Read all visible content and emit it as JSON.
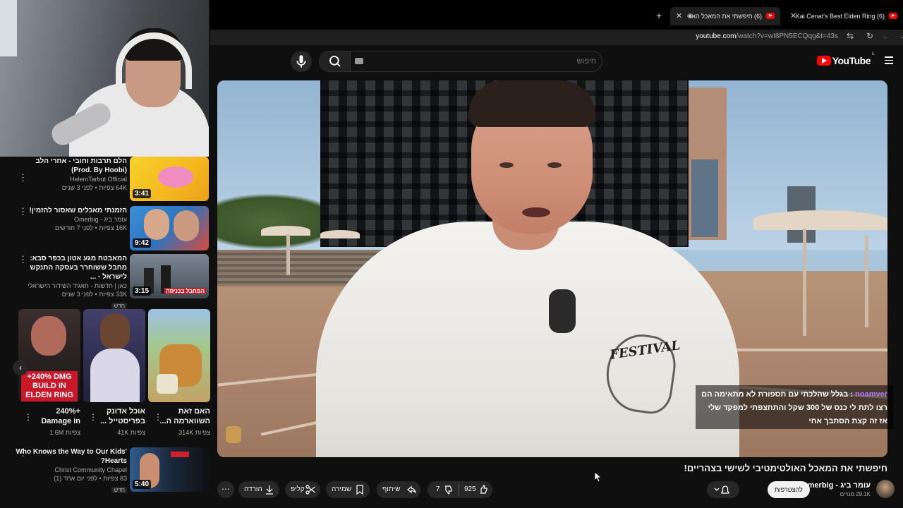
{
  "browser": {
    "tabs": [
      {
        "label": "(6) Kai Cenat's Best Elden Ring",
        "active": false
      },
      {
        "label": "(6) חיפשתי את המאכל האו",
        "active": true
      }
    ],
    "url_host": "youtube.com",
    "url_path": "/watch?v=wI8PN5ECQqg&t=43s"
  },
  "youtube": {
    "logo_text": "YouTube",
    "logo_sup": "IL",
    "search_placeholder": "חיפוש"
  },
  "sidebar": {
    "recs": [
      {
        "title": "הלם תרבות וחובי - אחרי הלב (Prod. By Hoobi)",
        "channel": "HelemTarbut Official",
        "meta": "64K צפיות • לפני 3 שנים",
        "duration": "3:41",
        "new": ""
      },
      {
        "title": "הזמנתי מאכלים שאסור להזמין!",
        "channel": "עומר ביג - Omerbig",
        "meta": "16K צפיות • לפני 7 חודשים",
        "duration": "9:42",
        "new": ""
      },
      {
        "title": "המאבטח מגע אטון בכפר סבא: מחבל ששוחרר בעסקה התנקש לישראל - ...",
        "channel": "כאן | חדשות - תאגיד השידור הישראלי",
        "meta": "33K צפיות • לפני 3 שנים",
        "duration": "3:15",
        "new": "חדש"
      },
      {
        "title": "Who Knows the Way to Our Kids' Hearts?",
        "channel": "Christ Community Chapel",
        "meta": "83 צפיות • לפני יום אחד (1)",
        "duration": "5:40",
        "new": "חדש"
      }
    ],
    "shorts": [
      {
        "title": "+240% Damage in",
        "views": "1.6M צפיות",
        "overlay": "+240% DMG BUILD IN ELDEN RING"
      },
      {
        "title": "אוכל אדונק בפריסטייל ...",
        "views": "41K צפיות",
        "overlay": ""
      },
      {
        "title": "האם זאת השווארמה ה...",
        "views": "314K צפיות",
        "overlay": ""
      }
    ],
    "thumb3_caption": "המחבל בכניסה"
  },
  "video": {
    "title": "חיפשתי את המאכל האולטימטיבי לשישי בצהריים!",
    "shirt_text": "FESTIVAL",
    "chat": {
      "author": "noamver",
      "message": "בגלל שהלכתי עם תספורת לא מתאימה הם רצו לתת לי כנס של 300 שקל והתחצפתי למפקד שלי אז זה קצת הסתבך אחי"
    }
  },
  "channel": {
    "name": "עומר ביג - Omerbig",
    "subs": "29.1K מנויים",
    "join_label": "להצטרפות"
  },
  "actions": {
    "likes": "925",
    "dislikes": "7",
    "share": "שיתוף",
    "save": "שמירה",
    "clip": "קליפ",
    "download": "הורדה"
  }
}
